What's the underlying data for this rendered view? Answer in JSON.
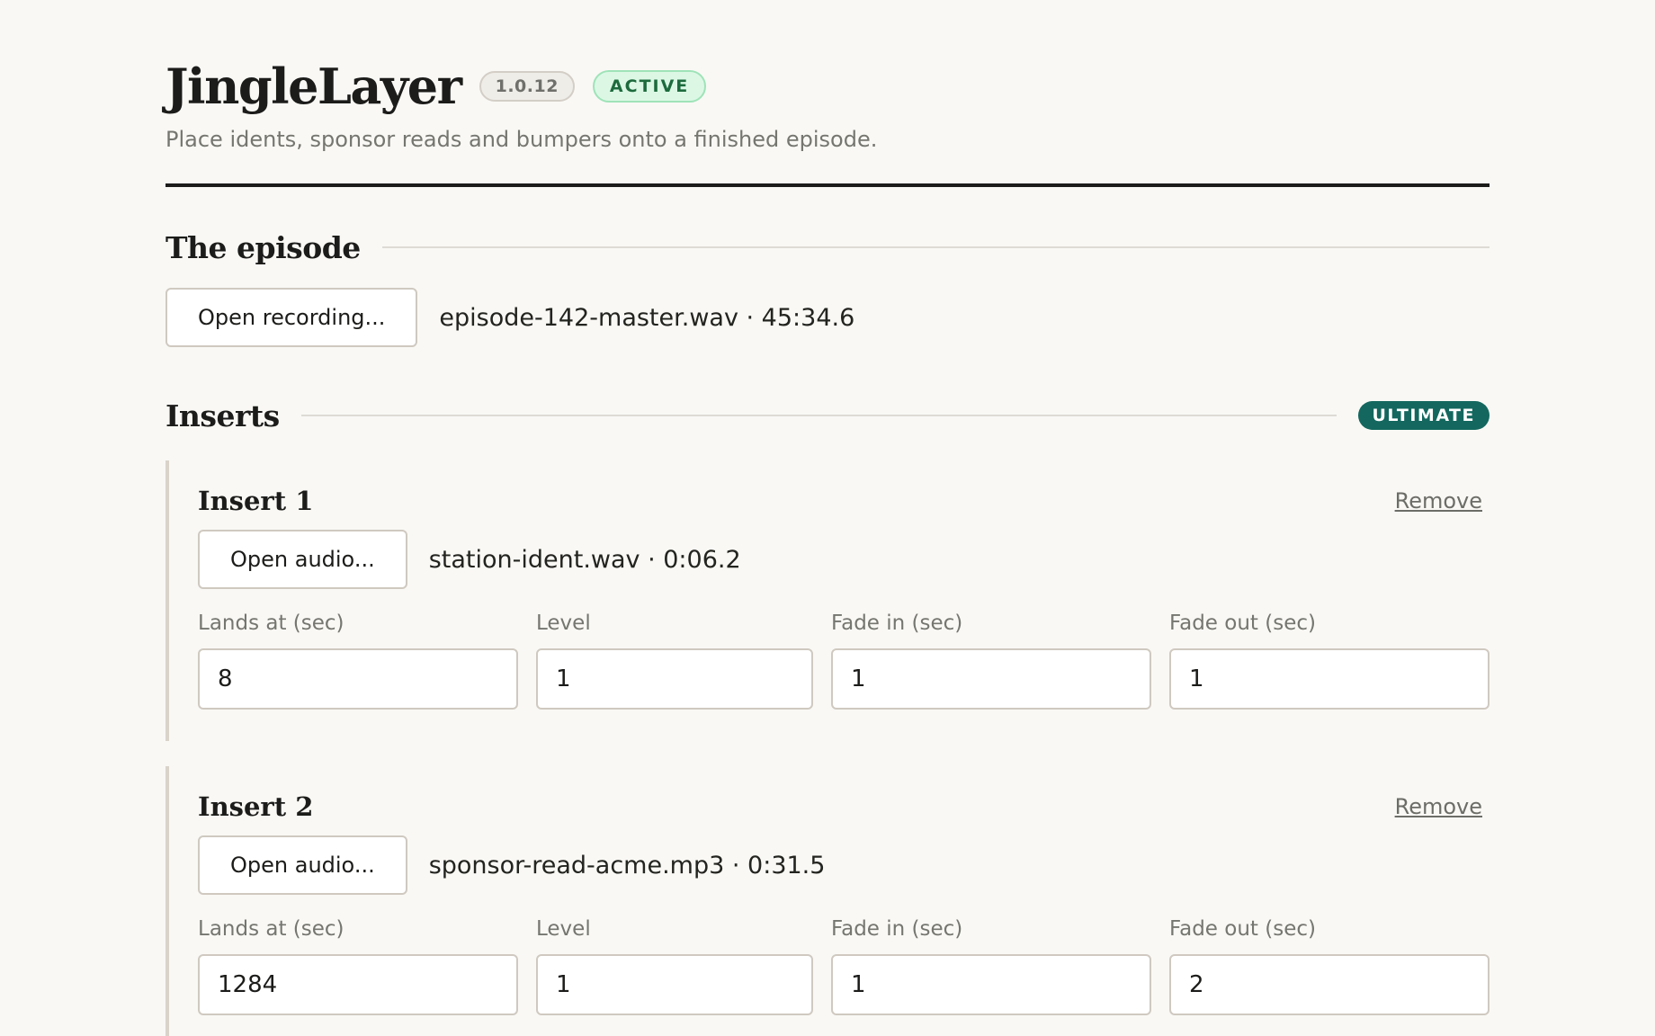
{
  "app": {
    "title": "JingleLayer",
    "version": "1.0.12",
    "status": "ACTIVE",
    "subtitle": "Place idents, sponsor reads and bumpers onto a finished episode."
  },
  "episode": {
    "section_title": "The episode",
    "open_button": "Open recording...",
    "file_info": "episode-142-master.wav · 45:34.6"
  },
  "inserts": {
    "section_title": "Inserts",
    "tier_badge": "ULTIMATE",
    "items": [
      {
        "title": "Insert 1",
        "remove_label": "Remove",
        "open_button": "Open audio...",
        "file_info": "station-ident.wav · 0:06.2",
        "fields": {
          "lands_at": {
            "label": "Lands at (sec)",
            "value": "8"
          },
          "level": {
            "label": "Level",
            "value": "1"
          },
          "fade_in": {
            "label": "Fade in (sec)",
            "value": "1"
          },
          "fade_out": {
            "label": "Fade out (sec)",
            "value": "1"
          }
        }
      },
      {
        "title": "Insert 2",
        "remove_label": "Remove",
        "open_button": "Open audio...",
        "file_info": "sponsor-read-acme.mp3 · 0:31.5",
        "fields": {
          "lands_at": {
            "label": "Lands at (sec)",
            "value": "1284"
          },
          "level": {
            "label": "Level",
            "value": "1"
          },
          "fade_in": {
            "label": "Fade in (sec)",
            "value": "1"
          },
          "fade_out": {
            "label": "Fade out (sec)",
            "value": "2"
          }
        }
      }
    ]
  },
  "colors": {
    "background": "#f9f8f5",
    "text": "#1c1c1a",
    "status_bg": "#dcf8e5",
    "status_text": "#1d6b3d",
    "tier_badge_bg": "#13675e"
  }
}
